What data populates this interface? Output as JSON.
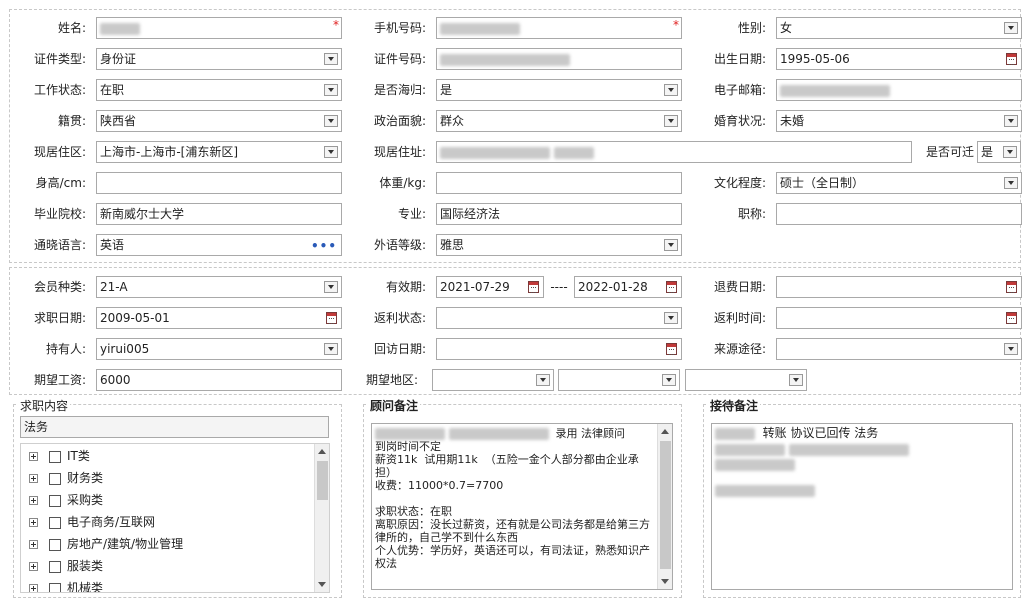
{
  "personal": {
    "name_label": "姓名:",
    "mobile_label": "手机号码:",
    "gender_label": "性别:",
    "gender_value": "女",
    "id_type_label": "证件类型:",
    "id_type_value": "身份证",
    "id_no_label": "证件号码:",
    "birth_label": "出生日期:",
    "birth_value": "1995-05-06",
    "work_status_label": "工作状态:",
    "work_status_value": "在职",
    "returnee_label": "是否海归:",
    "returnee_value": "是",
    "email_label": "电子邮箱:",
    "origin_label": "籍贯:",
    "origin_value": "陕西省",
    "political_label": "政治面貌:",
    "political_value": "群众",
    "marital_label": "婚育状况:",
    "marital_value": "未婚",
    "region_label": "现居住区:",
    "region_value": "上海市-上海市-[浦东新区]",
    "address_label": "现居住址:",
    "migrate_label": "是否可迁",
    "migrate_value": "是",
    "height_label": "身高/cm:",
    "height_value": "",
    "weight_label": "体重/kg:",
    "weight_value": "",
    "education_label": "文化程度:",
    "education_value": "硕士（全日制）",
    "school_label": "毕业院校:",
    "school_value": "新南威尔士大学",
    "major_label": "专业:",
    "major_value": "国际经济法",
    "title_label": "职称:",
    "title_value": "",
    "language_label": "通晓语言:",
    "language_value": "英语",
    "lang_level_label": "外语等级:",
    "lang_level_value": "雅思"
  },
  "membership": {
    "member_type_label": "会员种类:",
    "member_type_value": "21-A",
    "valid_label": "有效期:",
    "valid_from": "2021-07-29",
    "valid_sep": "----",
    "valid_to": "2022-01-28",
    "refund_date_label": "退费日期:",
    "refund_date_value": "",
    "job_date_label": "求职日期:",
    "job_date_value": "2009-05-01",
    "rebate_status_label": "返利状态:",
    "rebate_status_value": "",
    "rebate_time_label": "返利时间:",
    "rebate_time_value": "",
    "holder_label": "持有人:",
    "holder_value": "yirui005",
    "revisit_label": "回访日期:",
    "revisit_value": "",
    "source_label": "来源途径:",
    "source_value": "",
    "salary_label": "期望工资:",
    "salary_value": "6000",
    "area_label": "期望地区:"
  },
  "job_content": {
    "title": "求职内容",
    "search_value": "法务",
    "categories": [
      "IT类",
      "财务类",
      "采购类",
      "电子商务/互联网",
      "房地产/建筑/物业管理",
      "服装类",
      "机械类"
    ]
  },
  "advisor_note": {
    "title": "顾问备注",
    "line1_tail": "录用   法律顾问",
    "body": "到岗时间不定\n薪资11k  试用期11k  （五险一金个人部分都由企业承担）\n收费：11000*0.7=7700\n\n求职状态：在职\n离职原因：没长过薪资，还有就是公司法务都是给第三方律所的，自己学不到什么东西\n个人优势：学历好，英语还可以，有司法证，熟悉知识产权法"
  },
  "reception_note": {
    "title": "接待备注",
    "line1_tail": "转账  协议已回传     法务"
  }
}
